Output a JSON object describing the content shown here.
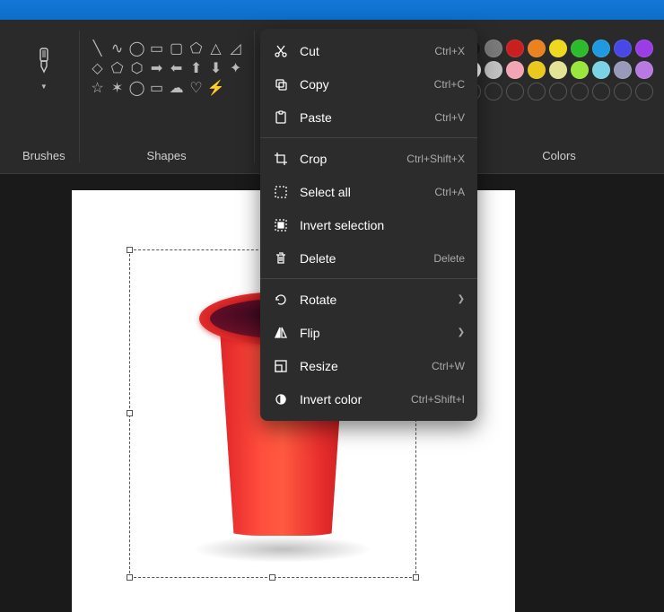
{
  "titlebar": {},
  "ribbon": {
    "brushes_label": "Brushes",
    "shapes_label": "Shapes",
    "colors_label": "Colors",
    "colors_row1": [
      "#1a1a1a",
      "#7a7a7a",
      "#c81f1f",
      "#e9821f",
      "#eed91f",
      "#2bbb2b",
      "#1f9ae0",
      "#4848e6",
      "#9a3de6"
    ],
    "colors_row2": [
      "#ffffff",
      "#c2c2c2",
      "#f2a6b4",
      "#e9c81f",
      "#e3e396",
      "#9ae63d",
      "#7ad4e6",
      "#9999b9",
      "#b87ae2"
    ]
  },
  "context_menu": {
    "items": [
      {
        "icon": "cut-icon",
        "label": "Cut",
        "shortcut": "Ctrl+X"
      },
      {
        "icon": "copy-icon",
        "label": "Copy",
        "shortcut": "Ctrl+C"
      },
      {
        "icon": "paste-icon",
        "label": "Paste",
        "shortcut": "Ctrl+V"
      },
      {
        "sep": true
      },
      {
        "icon": "crop-icon",
        "label": "Crop",
        "shortcut": "Ctrl+Shift+X"
      },
      {
        "icon": "select-all-icon",
        "label": "Select all",
        "shortcut": "Ctrl+A"
      },
      {
        "icon": "invert-selection-icon",
        "label": "Invert selection",
        "shortcut": ""
      },
      {
        "icon": "delete-icon",
        "label": "Delete",
        "shortcut": "Delete"
      },
      {
        "sep": true
      },
      {
        "icon": "rotate-icon",
        "label": "Rotate",
        "submenu": true
      },
      {
        "icon": "flip-icon",
        "label": "Flip",
        "submenu": true
      },
      {
        "icon": "resize-icon",
        "label": "Resize",
        "shortcut": "Ctrl+W"
      },
      {
        "icon": "invert-color-icon",
        "label": "Invert color",
        "shortcut": "Ctrl+Shift+I"
      }
    ]
  },
  "canvas": {
    "image_description": "red plastic cup",
    "selection_active": true
  }
}
